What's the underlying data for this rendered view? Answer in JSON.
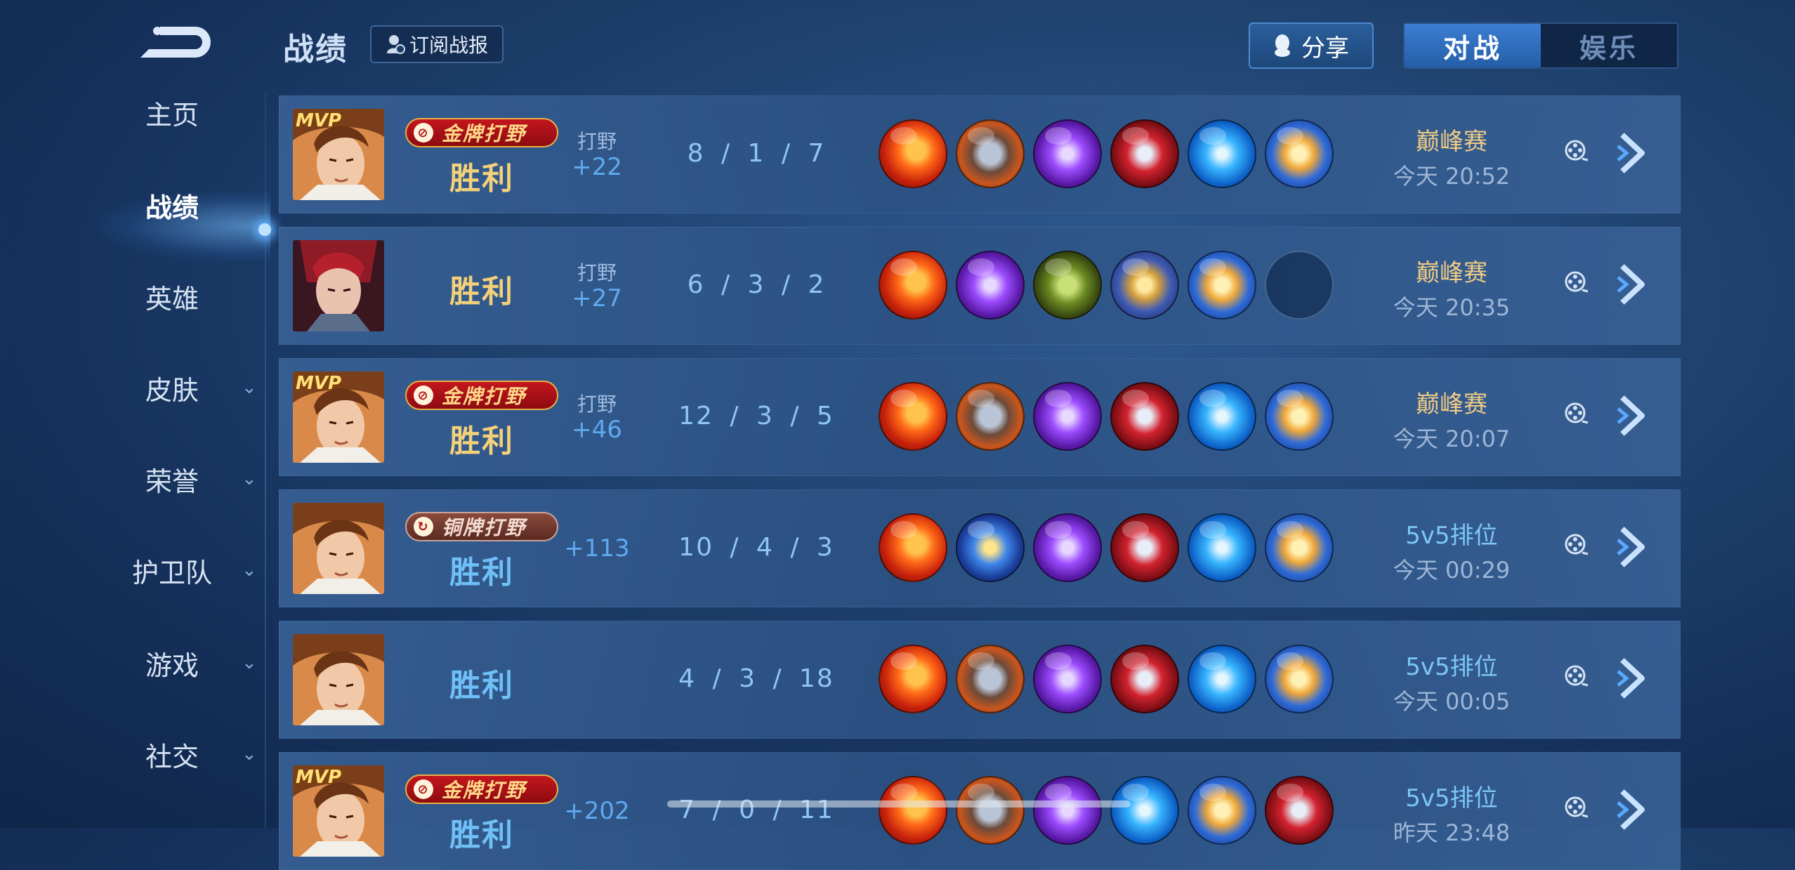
{
  "header": {
    "title": "战绩",
    "subscribe_label": "订阅战报",
    "share_label": "分享",
    "tabs": [
      {
        "label": "对战",
        "active": true
      },
      {
        "label": "娱乐",
        "active": false
      }
    ]
  },
  "sidebar": {
    "items": [
      {
        "label": "主页",
        "has_chevron": false
      },
      {
        "label": "战绩",
        "has_chevron": false,
        "active": true
      },
      {
        "label": "英雄",
        "has_chevron": false
      },
      {
        "label": "皮肤",
        "has_chevron": true
      },
      {
        "label": "荣誉",
        "has_chevron": true
      },
      {
        "label": "护卫队",
        "has_chevron": true
      },
      {
        "label": "游戏",
        "has_chevron": true
      },
      {
        "label": "社交",
        "has_chevron": true
      }
    ]
  },
  "matches": [
    {
      "mvp_label": "MVP",
      "badge": {
        "text": "金牌打野",
        "tier": "gold"
      },
      "result": "胜利",
      "result_color": "gold",
      "position": "打野",
      "score": "+22",
      "kda": "8 / 1 / 7",
      "items": [
        "red-fist",
        "boots",
        "purple-axe",
        "red-blade",
        "blue-sword",
        "gold-claw"
      ],
      "mode": "巅峰赛",
      "mode_color": "gold",
      "time": "今天 20:52",
      "hero": "hero-a"
    },
    {
      "mvp_label": "",
      "badge": null,
      "result": "胜利",
      "result_color": "gold",
      "position": "打野",
      "score": "+27",
      "kda": "6 / 3 / 2",
      "items": [
        "red-fist",
        "purple-axe",
        "green-armor",
        "star-gear",
        "gold-claw",
        "empty"
      ],
      "mode": "巅峰赛",
      "mode_color": "gold",
      "time": "今天 20:35",
      "hero": "hero-b"
    },
    {
      "mvp_label": "MVP",
      "badge": {
        "text": "金牌打野",
        "tier": "gold"
      },
      "result": "胜利",
      "result_color": "gold",
      "position": "打野",
      "score": "+46",
      "kda": "12 / 3 / 5",
      "items": [
        "red-fist",
        "boots",
        "purple-axe",
        "red-blade",
        "blue-sword",
        "gold-claw"
      ],
      "mode": "巅峰赛",
      "mode_color": "gold",
      "time": "今天 20:07",
      "hero": "hero-a"
    },
    {
      "mvp_label": "",
      "badge": {
        "text": "铜牌打野",
        "tier": "silver"
      },
      "result": "胜利",
      "result_color": "blue",
      "position": "",
      "score": "+113",
      "kda": "10 / 4 / 3",
      "items": [
        "red-fist",
        "blue-armor",
        "purple-axe",
        "red-blade",
        "blue-sword",
        "gold-claw"
      ],
      "mode": "5v5排位",
      "mode_color": "blue",
      "time": "今天 00:29",
      "hero": "hero-a"
    },
    {
      "mvp_label": "",
      "badge": null,
      "result": "胜利",
      "result_color": "blue",
      "position": "",
      "score": "",
      "kda": "4 / 3 / 18",
      "items": [
        "red-fist",
        "boots",
        "purple-axe",
        "red-blade",
        "blue-sword",
        "gold-claw"
      ],
      "mode": "5v5排位",
      "mode_color": "blue",
      "time": "今天 00:05",
      "hero": "hero-a"
    },
    {
      "mvp_label": "MVP",
      "badge": {
        "text": "金牌打野",
        "tier": "gold"
      },
      "result": "胜利",
      "result_color": "blue",
      "position": "",
      "score": "+202",
      "kda": "7 / 0 / 11",
      "items": [
        "red-fist",
        "boots",
        "purple-axe",
        "blue-sword",
        "gold-claw",
        "red-blade"
      ],
      "mode": "5v5排位",
      "mode_color": "blue",
      "time": "昨天 23:48",
      "hero": "hero-a"
    }
  ],
  "colors": {
    "background": "#1f426f",
    "gold_text": "#f3d07a",
    "blue_text": "#6fc0f6",
    "score_blue": "#5fa9ee",
    "active_tab": "#3c7ed2"
  },
  "icons": {
    "back": "back-arrow-icon",
    "subscribe": "bell-person-icon",
    "share": "qq-penguin-icon",
    "replay": "film-reel-icon",
    "detail": "chevron-right-icon"
  }
}
